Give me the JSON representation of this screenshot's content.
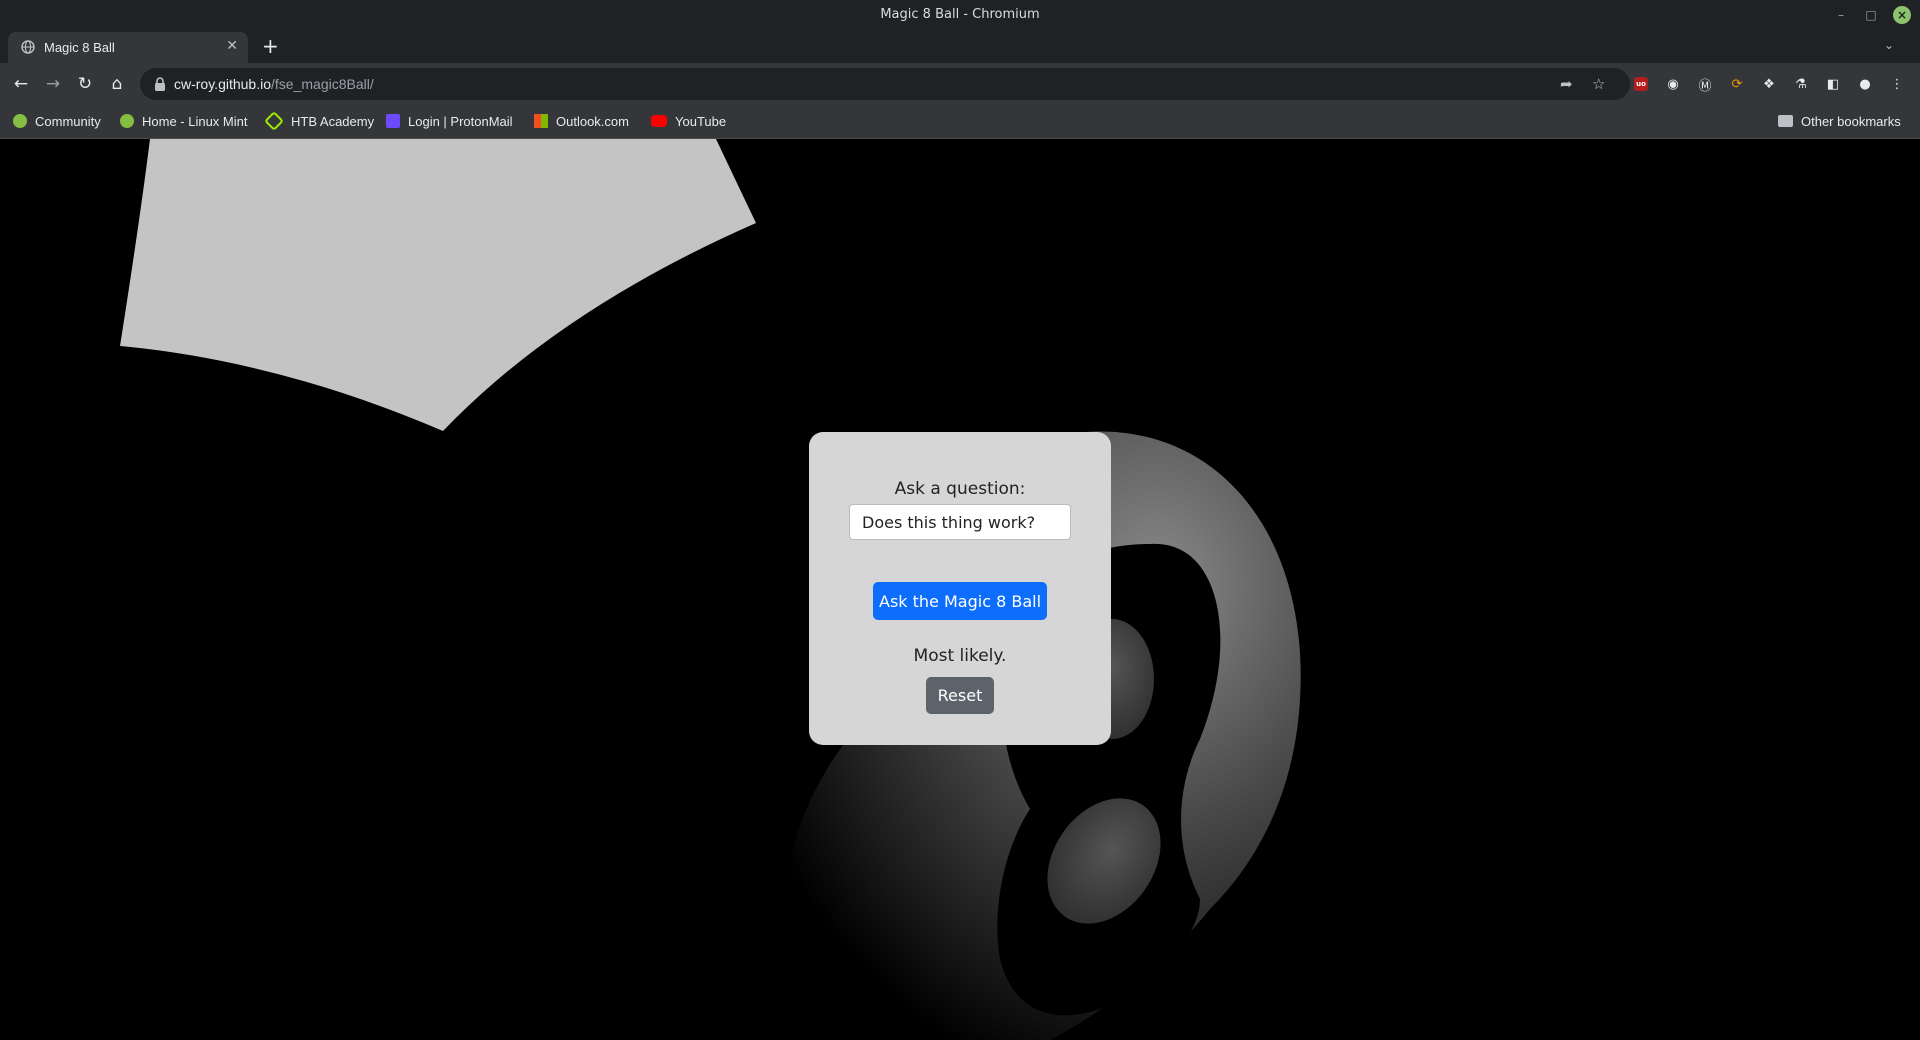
{
  "window": {
    "title": "Magic 8 Ball - Chromium"
  },
  "tab": {
    "title": "Magic 8 Ball"
  },
  "address_bar": {
    "host": "cw-roy.github.io",
    "path": "/fse_magic8Ball/"
  },
  "bookmarks": [
    {
      "label": "Community",
      "icon": "linux-mint-icon"
    },
    {
      "label": "Home - Linux Mint",
      "icon": "linux-mint-icon"
    },
    {
      "label": "HTB Academy",
      "icon": "htb-icon"
    },
    {
      "label": "Login | ProtonMail",
      "icon": "protonmail-icon"
    },
    {
      "label": "Outlook.com",
      "icon": "outlook-icon"
    },
    {
      "label": "YouTube",
      "icon": "youtube-icon"
    }
  ],
  "other_bookmarks": "Other bookmarks",
  "form": {
    "prompt_label": "Ask a question:",
    "question_value": "Does this thing work?",
    "ask_button": "Ask the Magic 8 Ball",
    "answer": "Most likely.",
    "reset_button": "Reset"
  },
  "colors": {
    "primary_button": "#0d6efd",
    "secondary_button": "#5c636a",
    "card_bg": "#d6d6d6",
    "page_bg": "#000000"
  }
}
